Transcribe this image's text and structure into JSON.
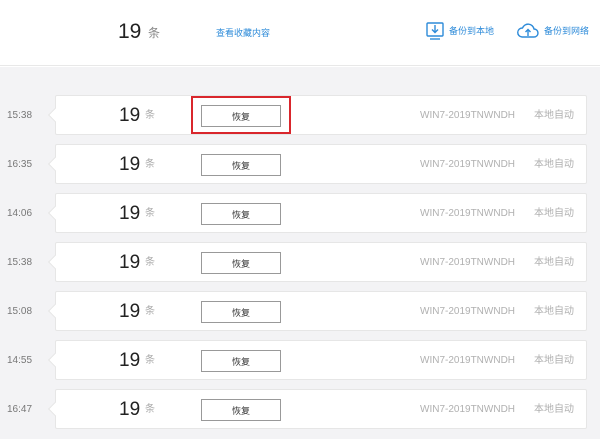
{
  "header": {
    "count": "19",
    "count_unit": "条",
    "view_link": "查看收藏内容",
    "backup_local": {
      "label": "备份到本地",
      "icon": "download-box-icon"
    },
    "backup_network": {
      "label": "备份到网络",
      "icon": "cloud-upload-icon"
    }
  },
  "colors": {
    "accent": "#2e8bd9",
    "highlight": "#d9262c",
    "list_background": "#f3f3f5"
  },
  "rows": [
    {
      "time": "15:38",
      "count": "19",
      "unit": "条",
      "action": "恢复",
      "device": "WIN7-2019TNWNDH",
      "mode": "本地自动",
      "highlighted": true
    },
    {
      "time": "16:35",
      "count": "19",
      "unit": "条",
      "action": "恢复",
      "device": "WIN7-2019TNWNDH",
      "mode": "本地自动",
      "highlighted": false
    },
    {
      "time": "14:06",
      "count": "19",
      "unit": "条",
      "action": "恢复",
      "device": "WIN7-2019TNWNDH",
      "mode": "本地自动",
      "highlighted": false
    },
    {
      "time": "15:38",
      "count": "19",
      "unit": "条",
      "action": "恢复",
      "device": "WIN7-2019TNWNDH",
      "mode": "本地自动",
      "highlighted": false
    },
    {
      "time": "15:08",
      "count": "19",
      "unit": "条",
      "action": "恢复",
      "device": "WIN7-2019TNWNDH",
      "mode": "本地自动",
      "highlighted": false
    },
    {
      "time": "14:55",
      "count": "19",
      "unit": "条",
      "action": "恢复",
      "device": "WIN7-2019TNWNDH",
      "mode": "本地自动",
      "highlighted": false
    },
    {
      "time": "16:47",
      "count": "19",
      "unit": "条",
      "action": "恢复",
      "device": "WIN7-2019TNWNDH",
      "mode": "本地自动",
      "highlighted": false
    }
  ]
}
